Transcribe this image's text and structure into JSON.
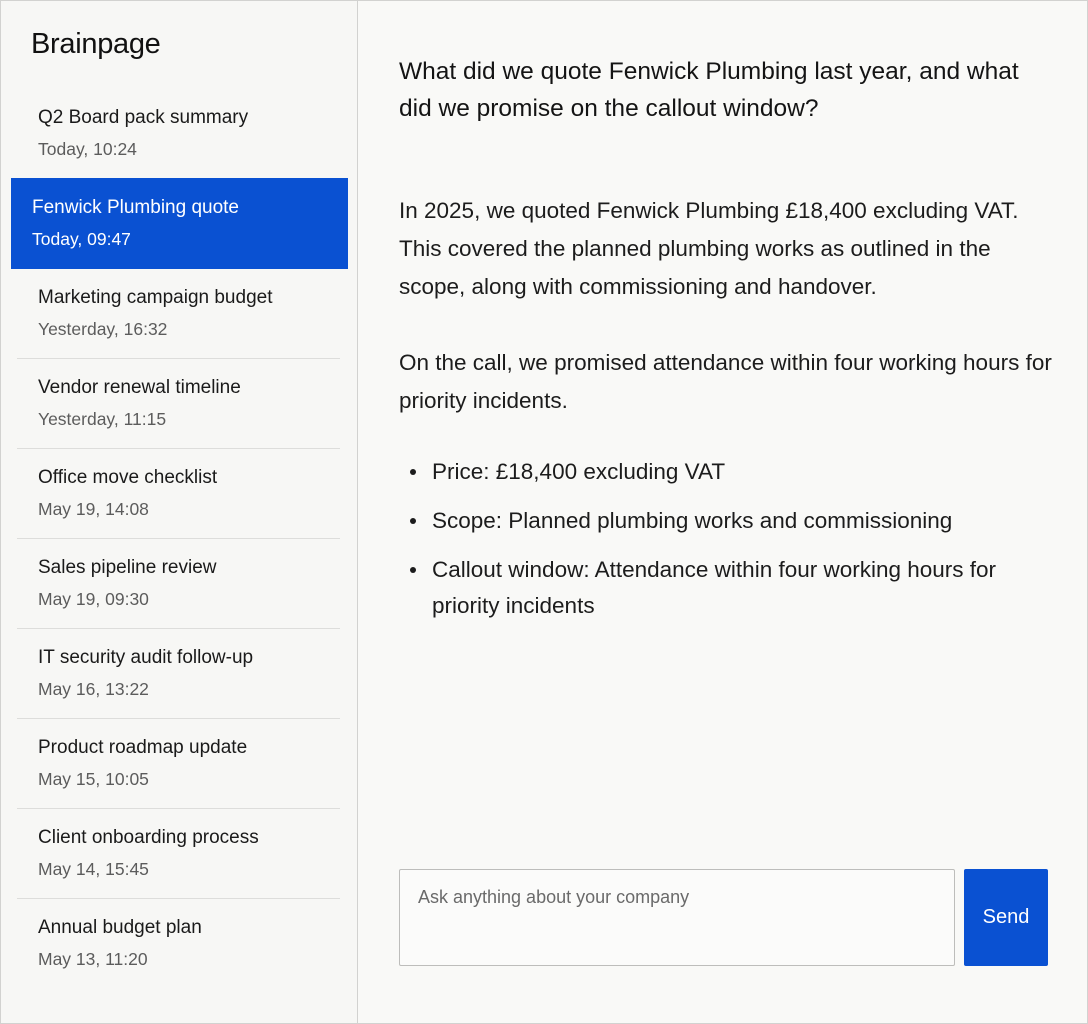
{
  "sidebar": {
    "brand": "Brainpage",
    "conversations": [
      {
        "title": "Q2 Board pack summary",
        "time": "Today, 10:24"
      },
      {
        "title": "Fenwick Plumbing quote",
        "time": "Today, 09:47"
      },
      {
        "title": "Marketing campaign budget",
        "time": "Yesterday, 16:32"
      },
      {
        "title": "Vendor renewal timeline",
        "time": "Yesterday, 11:15"
      },
      {
        "title": "Office move checklist",
        "time": "May 19, 14:08"
      },
      {
        "title": "Sales pipeline review",
        "time": "May 19, 09:30"
      },
      {
        "title": "IT security audit follow-up",
        "time": "May 16, 13:22"
      },
      {
        "title": "Product roadmap update",
        "time": "May 15, 10:05"
      },
      {
        "title": "Client onboarding process",
        "time": "May 14, 15:45"
      },
      {
        "title": "Annual budget plan",
        "time": "May 13, 11:20"
      }
    ],
    "active_index": 1
  },
  "chat": {
    "question": "What did we quote Fenwick Plumbing last year, and what did we promise on the callout window?",
    "answer_paragraphs": [
      "In 2025, we quoted Fenwick Plumbing £18,400 excluding VAT. This covered the planned plumbing works as outlined in the scope, along with commissioning and handover.",
      "On the call, we promised attendance within four working hours for priority incidents."
    ],
    "answer_bullets": [
      "Price: £18,400 excluding VAT",
      "Scope: Planned plumbing works and commissioning",
      "Callout window: Attendance within four working hours for priority incidents"
    ]
  },
  "composer": {
    "placeholder": "Ask anything about your company",
    "value": "",
    "send_label": "Send"
  },
  "colors": {
    "accent": "#0a51d2",
    "background": "#f9f9f7",
    "border": "#d2d2d0"
  }
}
